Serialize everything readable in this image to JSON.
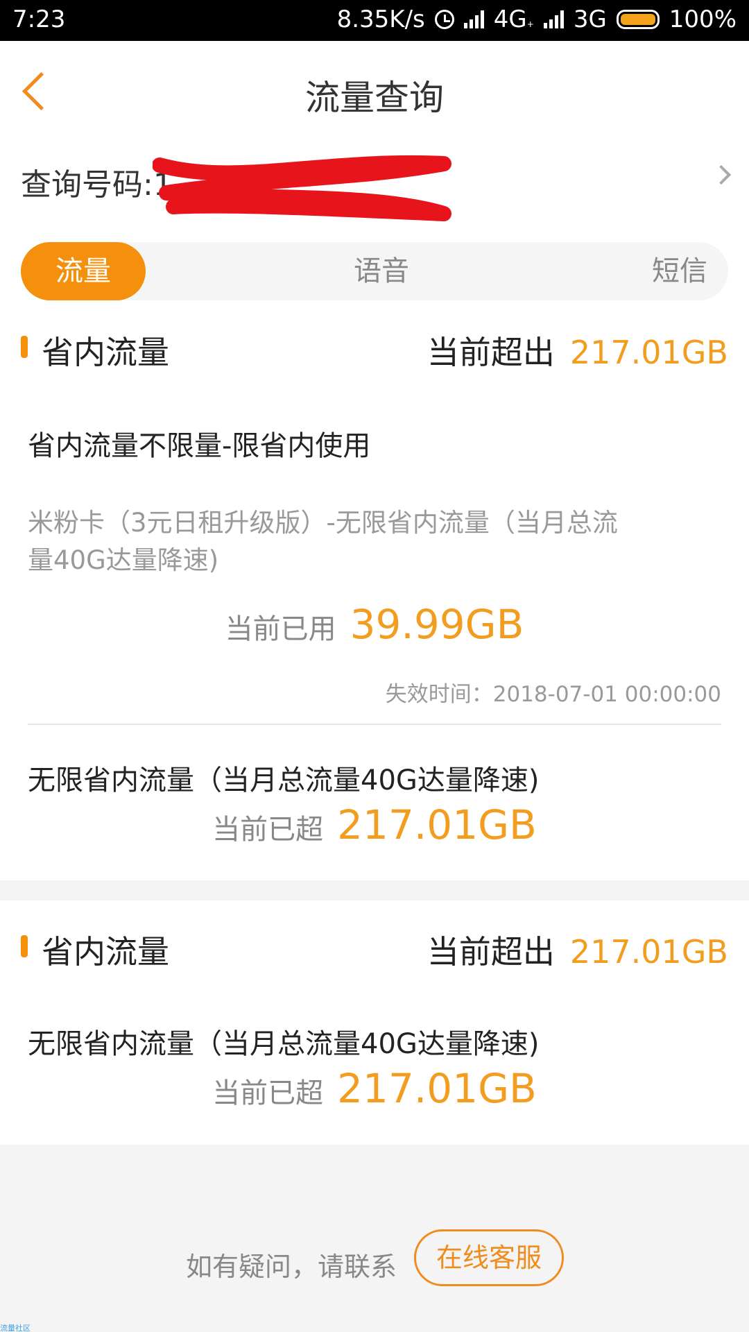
{
  "status_bar": {
    "time": "7:23",
    "net_speed": "8.35K/s",
    "net1": "4G",
    "net1_sub": "+",
    "net2": "3G",
    "battery": "100%",
    "battery_level": 1.0
  },
  "header": {
    "title": "流量查询"
  },
  "query": {
    "label": "查询号码:1"
  },
  "tabs": [
    {
      "label": "流量",
      "active": true
    },
    {
      "label": "语音",
      "active": false
    },
    {
      "label": "短信",
      "active": false
    }
  ],
  "sections": [
    {
      "name": "省内流量",
      "exceed_label": "当前超出",
      "exceed_value": "217.01GB",
      "package": {
        "title": "省内流量不限量-限省内使用",
        "desc": "米粉卡（3元日租升级版）-无限省内流量（当月总流量40G达量降速)",
        "used_label": "当前已用",
        "used_value": "39.99GB",
        "expire_text": "失效时间：2018-07-01 00:00:00"
      },
      "extra": {
        "title": "无限省内流量（当月总流量40G达量降速)",
        "over_label": "当前已超",
        "over_value": "217.01GB"
      }
    },
    {
      "name": "省内流量",
      "exceed_label": "当前超出",
      "exceed_value": "217.01GB",
      "extra": {
        "title": "无限省内流量（当月总流量40G达量降速)",
        "over_label": "当前已超",
        "over_value": "217.01GB"
      }
    }
  ],
  "footer": {
    "text": "如有疑问，请联系",
    "button": "在线客服"
  },
  "watermark": "流量社区",
  "colors": {
    "accent": "#f4900c",
    "value": "#f29d1f",
    "redaction": "#e8141b"
  }
}
